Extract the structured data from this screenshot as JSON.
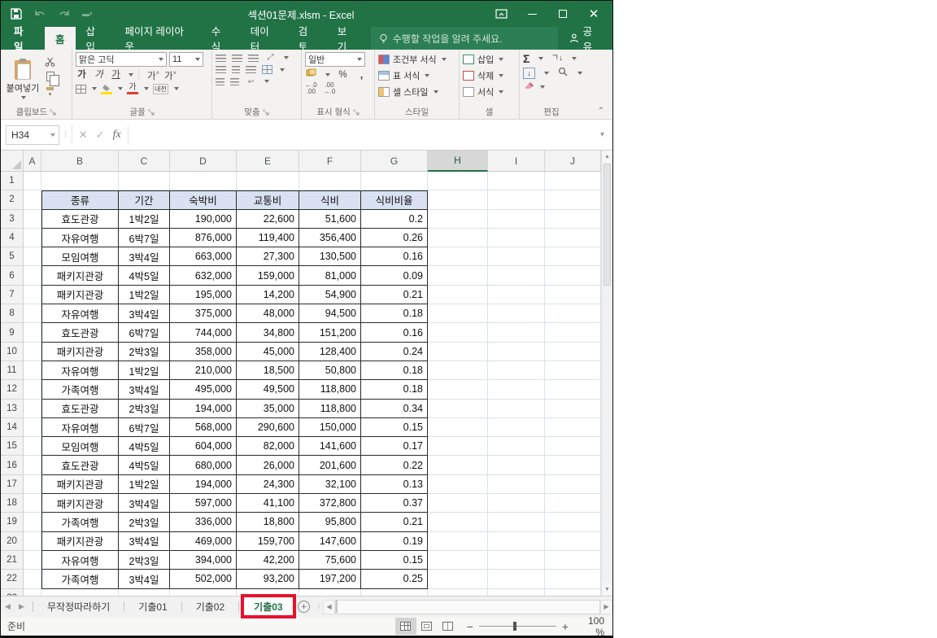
{
  "colors": {
    "excel_green": "#217346",
    "header_fill": "#D9E1F2",
    "annotation_red": "#E8112D",
    "selected_col_bg": "#D7D7D7"
  },
  "window": {
    "title": "섹션01문제.xlsm - Excel",
    "menu_tabs": [
      "파일",
      "홈",
      "삽입",
      "페이지 레이아웃",
      "수식",
      "데이터",
      "검토",
      "보기"
    ],
    "active_tab": "홈",
    "tell_me": "수행할 작업을 알려 주세요.",
    "share_label": "공유"
  },
  "ribbon": {
    "paste_label": "붙여넣기",
    "font_name": "맑은 고딕",
    "font_size": "11",
    "number_format": "일반",
    "phonetic_label": "내천",
    "groups": [
      "클립보드",
      "글꼴",
      "맞춤",
      "표시 형식",
      "스타일",
      "셀",
      "편집"
    ],
    "style_buttons": [
      "조건부 서식",
      "표 서식",
      "셀 스타일"
    ],
    "cell_buttons": [
      "삽입",
      "삭제",
      "서식"
    ],
    "bold_glyph": "가",
    "italic_glyph": "가",
    "underline_glyph": "가",
    "grow_glyph": "가",
    "shrink_glyph": "가",
    "percent_glyph": "%",
    "comma_glyph": ",",
    "dec_inc": ".0",
    "dec_dec": ".00",
    "sort_glyph": "ㄱ"
  },
  "formula_bar": {
    "name_box": "H34",
    "formula": ""
  },
  "grid": {
    "columns": [
      "A",
      "B",
      "C",
      "D",
      "E",
      "F",
      "G",
      "H",
      "I",
      "J"
    ],
    "selected_column": "H",
    "first_row": 1,
    "last_full_row": 22
  },
  "table": {
    "headers": [
      "종류",
      "기간",
      "숙박비",
      "교통비",
      "식비",
      "식비비율"
    ],
    "rows": [
      [
        "효도관광",
        "1박2일",
        "190,000",
        "22,600",
        "51,600",
        "0.2"
      ],
      [
        "자유여행",
        "6박7일",
        "876,000",
        "119,400",
        "356,400",
        "0.26"
      ],
      [
        "모임여행",
        "3박4일",
        "663,000",
        "27,300",
        "130,500",
        "0.16"
      ],
      [
        "패키지관광",
        "4박5일",
        "632,000",
        "159,000",
        "81,000",
        "0.09"
      ],
      [
        "패키지관광",
        "1박2일",
        "195,000",
        "14,200",
        "54,900",
        "0.21"
      ],
      [
        "자유여행",
        "3박4일",
        "375,000",
        "48,000",
        "94,500",
        "0.18"
      ],
      [
        "효도관광",
        "6박7일",
        "744,000",
        "34,800",
        "151,200",
        "0.16"
      ],
      [
        "패키지관광",
        "2박3일",
        "358,000",
        "45,000",
        "128,400",
        "0.24"
      ],
      [
        "자유여행",
        "1박2일",
        "210,000",
        "18,500",
        "50,800",
        "0.18"
      ],
      [
        "가족여행",
        "3박4일",
        "495,000",
        "49,500",
        "118,800",
        "0.18"
      ],
      [
        "효도관광",
        "2박3일",
        "194,000",
        "35,000",
        "118,800",
        "0.34"
      ],
      [
        "자유여행",
        "6박7일",
        "568,000",
        "290,600",
        "150,000",
        "0.15"
      ],
      [
        "모임여행",
        "4박5일",
        "604,000",
        "82,000",
        "141,600",
        "0.17"
      ],
      [
        "효도관광",
        "4박5일",
        "680,000",
        "26,000",
        "201,600",
        "0.22"
      ],
      [
        "패키지관광",
        "1박2일",
        "194,000",
        "24,300",
        "32,100",
        "0.13"
      ],
      [
        "패키지관광",
        "3박4일",
        "597,000",
        "41,100",
        "372,800",
        "0.37"
      ],
      [
        "가족여행",
        "2박3일",
        "336,000",
        "18,800",
        "95,800",
        "0.21"
      ],
      [
        "패키지관광",
        "3박4일",
        "469,000",
        "159,700",
        "147,600",
        "0.19"
      ],
      [
        "자유여행",
        "2박3일",
        "394,000",
        "42,200",
        "75,600",
        "0.15"
      ],
      [
        "가족여행",
        "3박4일",
        "502,000",
        "93,200",
        "197,200",
        "0.25"
      ]
    ]
  },
  "sheet_tabs": {
    "tabs": [
      "무작정따라하기",
      "기출01",
      "기출02",
      "기출03"
    ],
    "active": "기출03"
  },
  "status_bar": {
    "ready": "준비",
    "zoom": "100 %"
  }
}
